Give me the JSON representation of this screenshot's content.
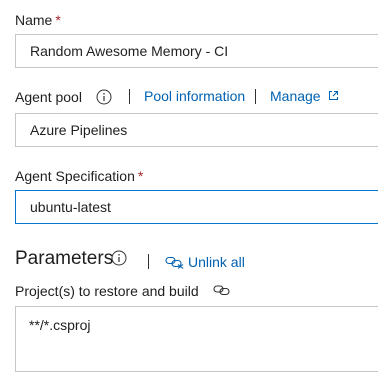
{
  "name_field": {
    "label": "Name",
    "required_mark": "*",
    "value": "Random Awesome Memory - CI"
  },
  "agent_pool": {
    "label": "Agent pool",
    "pool_info_link": "Pool information",
    "manage_link": "Manage",
    "value": "Azure Pipelines"
  },
  "agent_spec": {
    "label": "Agent Specification",
    "required_mark": "*",
    "value": "ubuntu-latest"
  },
  "parameters": {
    "heading": "Parameters",
    "unlink_all": "Unlink all"
  },
  "projects": {
    "label": "Project(s) to restore and build",
    "value": "**/*.csproj"
  },
  "colors": {
    "link": "#0062b3",
    "required": "#a4262c",
    "focus_border": "#0078d4",
    "border": "#c8c6c4"
  },
  "icons": [
    "info-icon",
    "external-link-icon",
    "unlink-icon",
    "link-chain-icon"
  ]
}
